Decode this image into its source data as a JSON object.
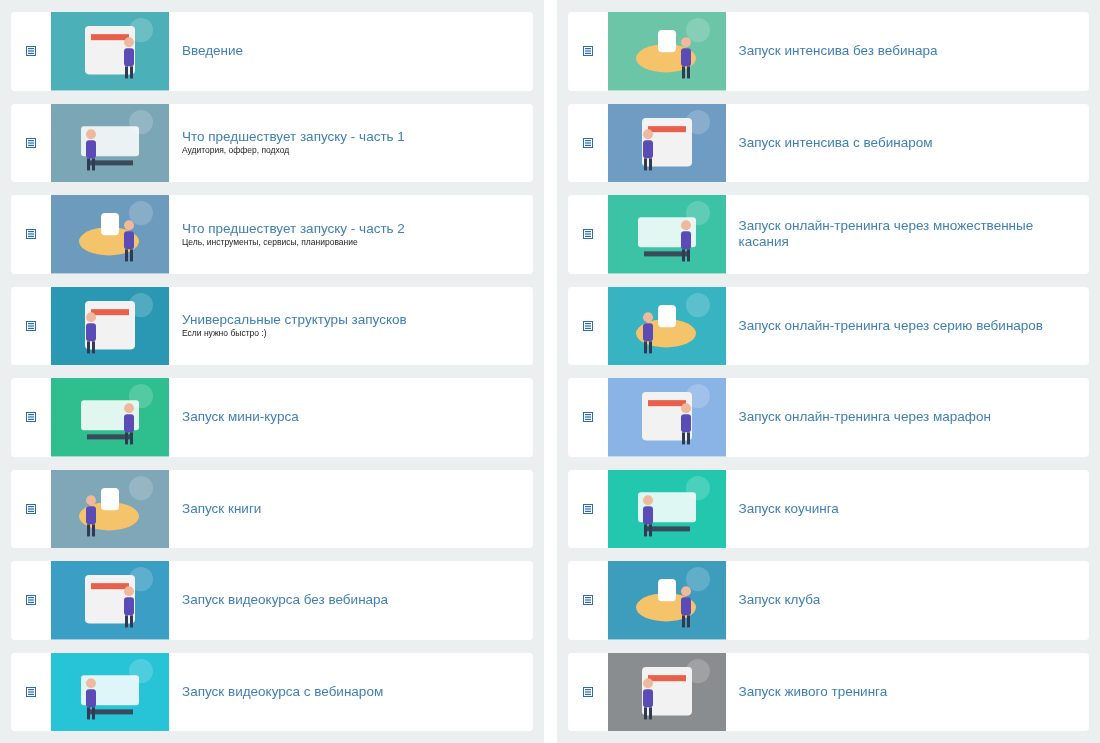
{
  "columns": [
    {
      "lessons": [
        {
          "title": "Введение"
        },
        {
          "title": "Что предшествует запуску - часть 1",
          "subtitle": "Аудитория, оффер, подход"
        },
        {
          "title": "Что предшествует запуску - часть 2",
          "subtitle": "Цель, инструменты, сервисы, планирование"
        },
        {
          "title": "Универсальные структуры запусков",
          "subtitle": "Если нужно быстро :)"
        },
        {
          "title": "Запуск мини-курса"
        },
        {
          "title": "Запуск книги"
        },
        {
          "title": "Запуск видеокурса без вебинара"
        },
        {
          "title": "Запуск видеокурса с вебинаром"
        }
      ]
    },
    {
      "lessons": [
        {
          "title": "Запуск интенсива без вебинара"
        },
        {
          "title": "Запуск интенсива с вебинаром"
        },
        {
          "title": "Запуск онлайн-тренинга через множественные касания"
        },
        {
          "title": "Запуск онлайн-тренинга через серию вебинаров"
        },
        {
          "title": "Запуск онлайн-тренинга через марафон"
        },
        {
          "title": "Запуск коучинга"
        },
        {
          "title": "Запуск клуба"
        },
        {
          "title": "Запуск живого тренинга"
        }
      ]
    }
  ]
}
